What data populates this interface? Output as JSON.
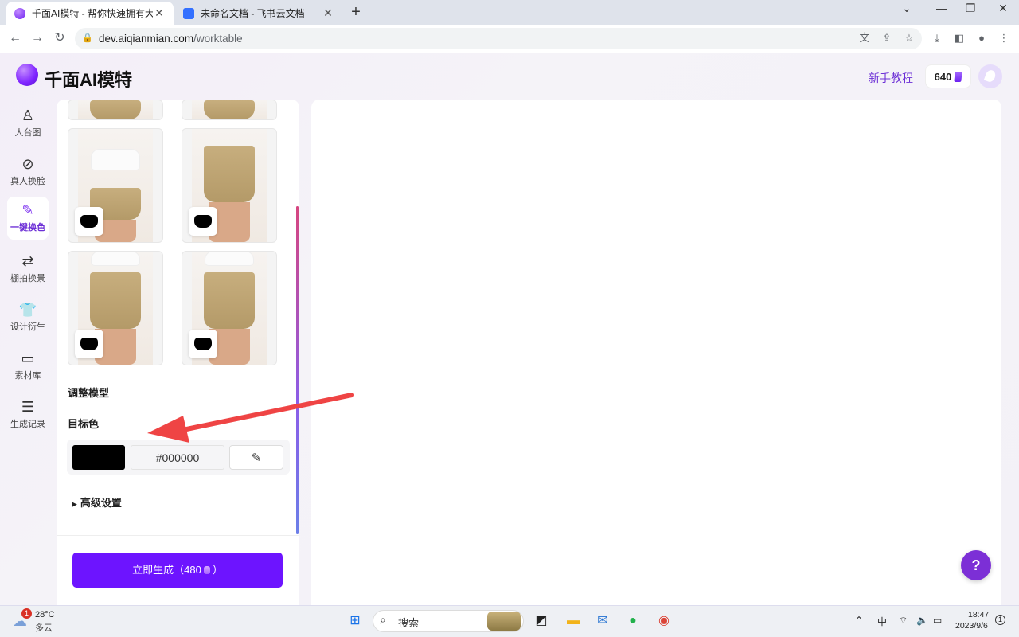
{
  "browser": {
    "tabs": [
      {
        "title": "千面AI模特 - 帮你快速拥有大牌同",
        "active": true
      },
      {
        "title": "未命名文档 - 飞书云文档",
        "active": false
      }
    ],
    "new_tab": "+",
    "url_host": "dev.aiqianmian.com",
    "url_path": "/worktable",
    "window_controls": [
      "⌄",
      "—",
      "❐",
      "✕"
    ]
  },
  "app": {
    "name": "千面AI模特",
    "guide_link": "新手教程",
    "credits": "640"
  },
  "sidebar": {
    "items": [
      {
        "label": "人台图",
        "icon": "mannequin-icon",
        "glyph": "♙",
        "active": false
      },
      {
        "label": "真人换脸",
        "icon": "face-swap-icon",
        "glyph": "⊘",
        "active": false
      },
      {
        "label": "一键换色",
        "icon": "paint-bucket-icon",
        "glyph": "✎",
        "active": true
      },
      {
        "label": "棚拍换景",
        "icon": "scene-swap-icon",
        "glyph": "⇄",
        "active": false
      },
      {
        "label": "设计衍生",
        "icon": "tshirt-icon",
        "glyph": "👕",
        "active": false
      },
      {
        "label": "素材库",
        "icon": "folder-icon",
        "glyph": "▭",
        "active": false
      },
      {
        "label": "生成记录",
        "icon": "list-icon",
        "glyph": "☰",
        "active": false
      }
    ]
  },
  "panel": {
    "adjust_model_label": "调整模型",
    "target_color_label": "目标色",
    "target_color_value": "#000000",
    "advanced_label": "高级设置",
    "generate_label": "立即生成（480",
    "generate_suffix": "）",
    "accent_color": "#6d14ff"
  },
  "help_button": "?",
  "taskbar": {
    "weather_temp": "28°C",
    "weather_desc": "多云",
    "weather_badge": "1",
    "search_placeholder": "搜索",
    "ime": "中",
    "time": "18:47",
    "date": "2023/9/6",
    "notif_count": "1"
  }
}
